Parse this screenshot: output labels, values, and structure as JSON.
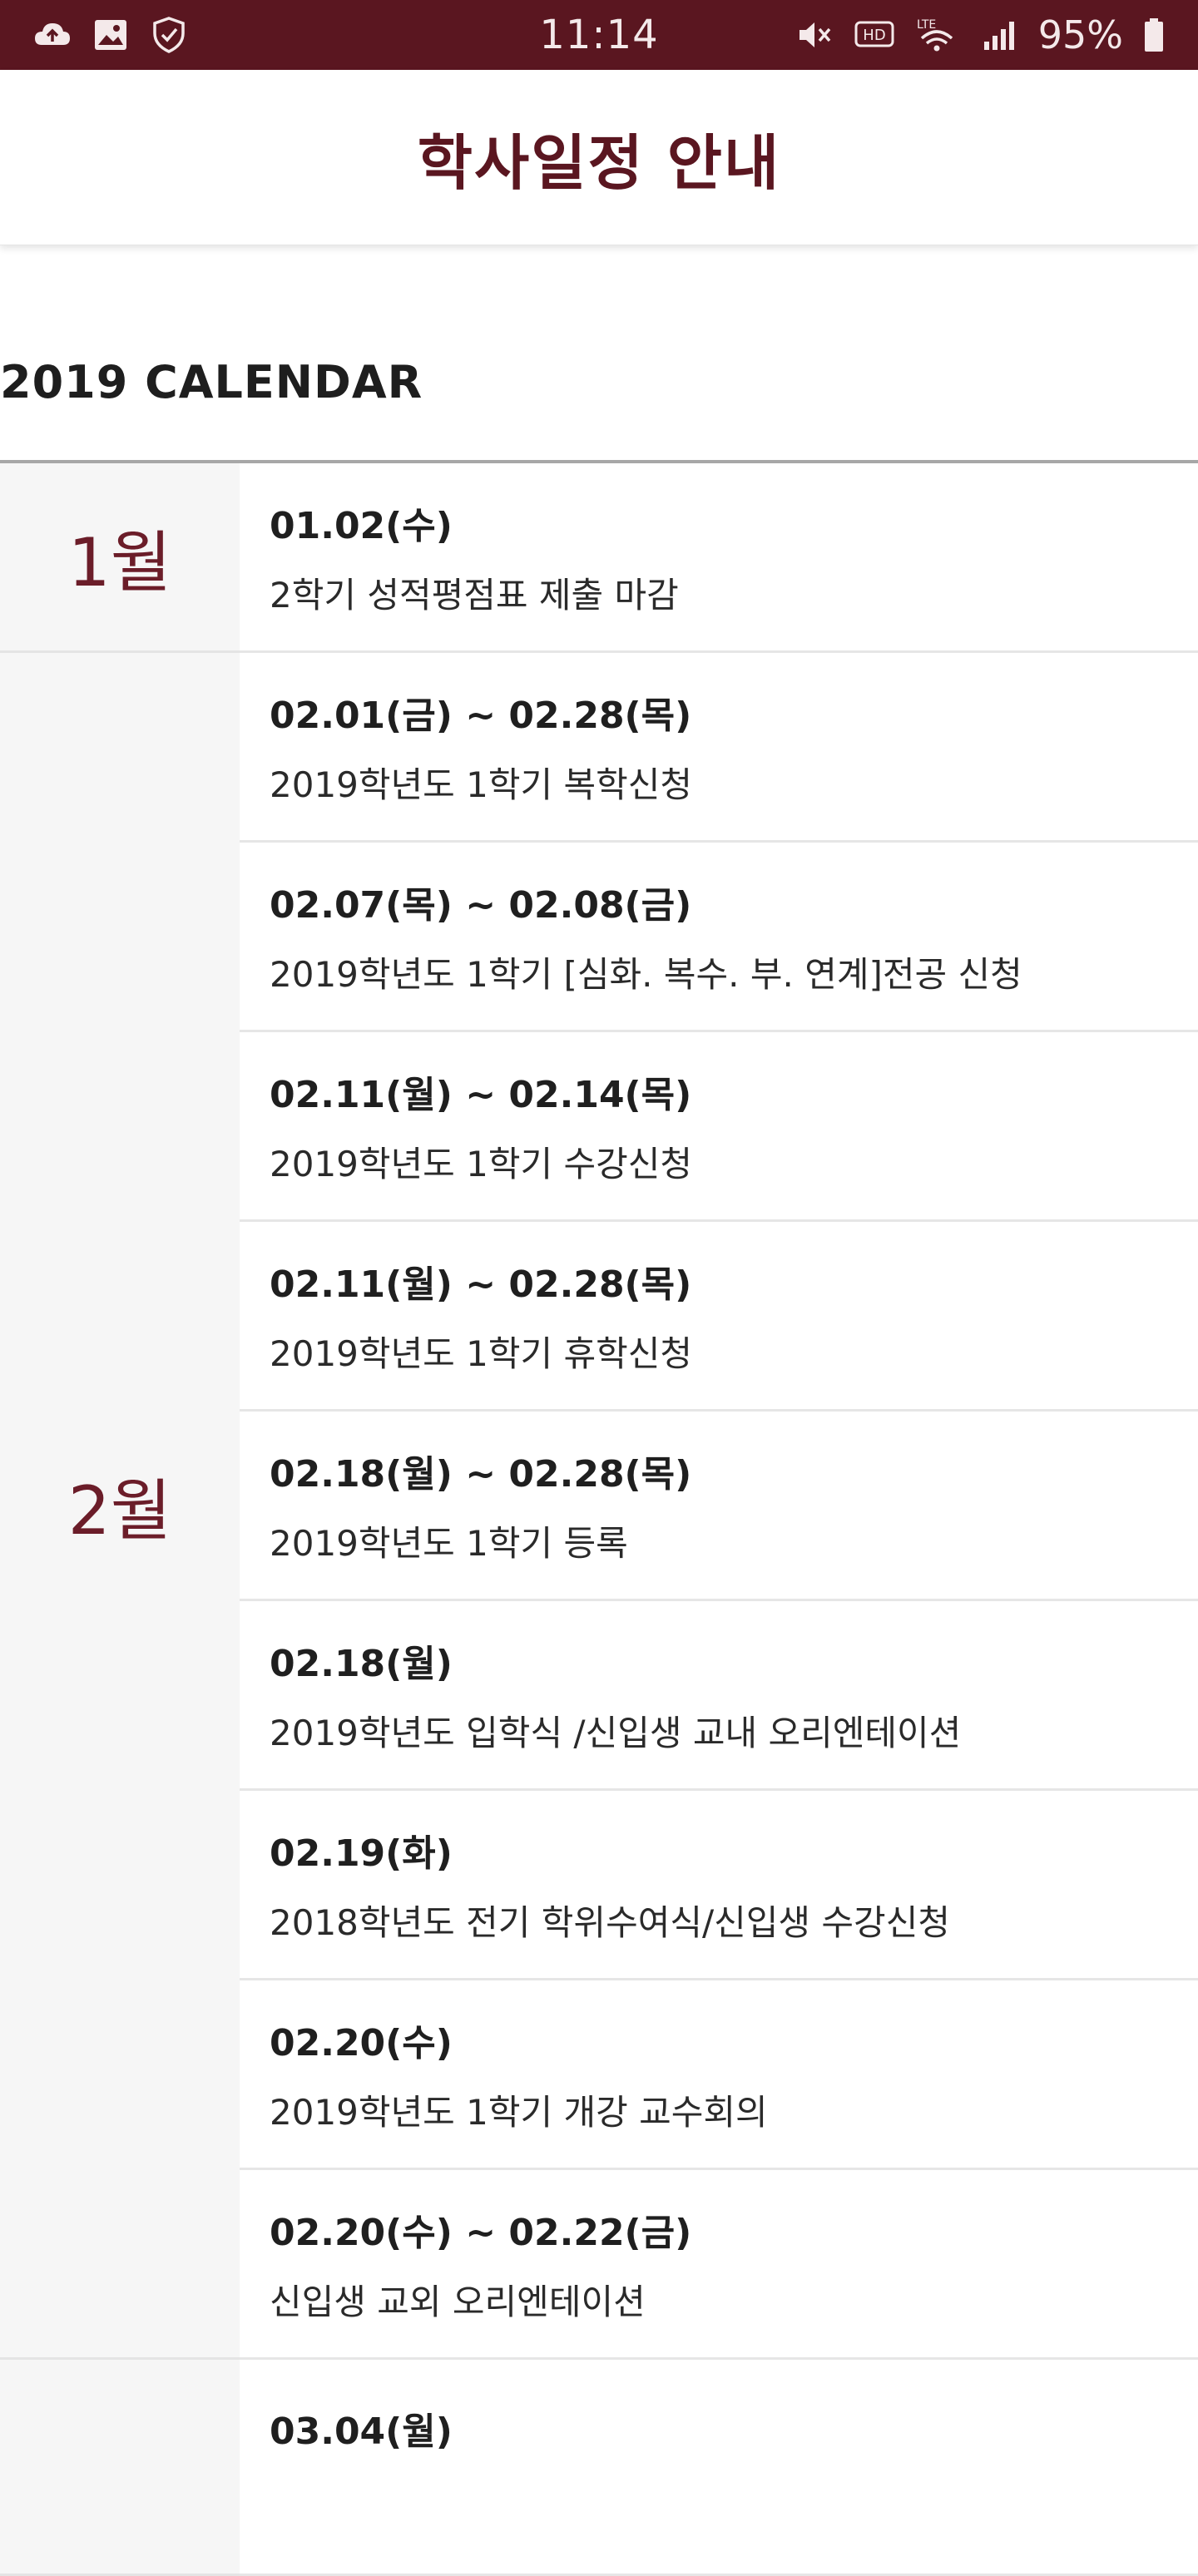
{
  "status_bar": {
    "time": "11:14",
    "battery": "95%",
    "left_icons": [
      "cloud-upload-icon",
      "gallery-icon",
      "shield-check-icon"
    ],
    "right_icons": [
      "mute-icon",
      "hd-voice-icon",
      "lte-wifi-icon",
      "signal-icon",
      "battery-icon"
    ],
    "hd_label": "HD",
    "lte_label": "LTE",
    "background": "#5a1620"
  },
  "header": {
    "title": "학사일정 안내",
    "title_color": "#5a1620"
  },
  "calendar": {
    "section_title": "2019 CALENDAR",
    "months": [
      {
        "label": "1월",
        "events": [
          {
            "date": "01.02(수)",
            "desc": "2학기 성적평점표 제출 마감"
          }
        ]
      },
      {
        "label": "2월",
        "events": [
          {
            "date": "02.01(금) ~ 02.28(목)",
            "desc": "2019학년도 1학기 복학신청"
          },
          {
            "date": "02.07(목) ~ 02.08(금)",
            "desc": "2019학년도 1학기 [심화. 복수. 부. 연계]전공 신청"
          },
          {
            "date": "02.11(월) ~ 02.14(목)",
            "desc": "2019학년도 1학기 수강신청"
          },
          {
            "date": "02.11(월) ~ 02.28(목)",
            "desc": "2019학년도 1학기 휴학신청"
          },
          {
            "date": "02.18(월) ~ 02.28(목)",
            "desc": "2019학년도 1학기 등록"
          },
          {
            "date": "02.18(월)",
            "desc": "2019학년도 입학식 /신입생 교내 오리엔테이션"
          },
          {
            "date": "02.19(화)",
            "desc": "2018학년도 전기 학위수여식/신입생 수강신청"
          },
          {
            "date": "02.20(수)",
            "desc": "2019학년도 1학기 개강 교수회의"
          },
          {
            "date": "02.20(수) ~ 02.22(금)",
            "desc": "신입생 교외 오리엔테이션"
          }
        ]
      },
      {
        "label": "",
        "events": [
          {
            "date": "03.04(월)",
            "desc": ""
          }
        ]
      }
    ]
  }
}
